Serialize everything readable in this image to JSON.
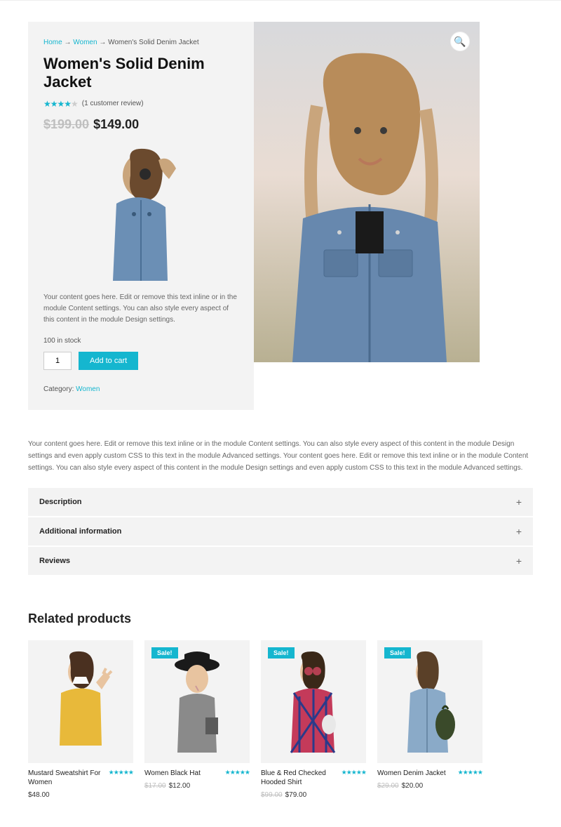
{
  "breadcrumb": {
    "home": "Home",
    "sep": "→",
    "cat": "Women",
    "current": "Women's Solid Denim Jacket"
  },
  "product": {
    "title": "Women's Solid Denim Jacket",
    "reviews_text": "(1 customer review)",
    "old_price": "$199.00",
    "price": "$149.00",
    "short_desc": "Your content goes here. Edit or remove this text inline or in the module Content settings. You can also style every aspect of this content in the module Design settings.",
    "stock": "100 in stock",
    "qty": "1",
    "add_to_cart": "Add to cart",
    "category_label": "Category:",
    "category_value": "Women"
  },
  "long_desc": "Your content goes here. Edit or remove this text inline or in the module Content settings. You can also style every aspect of this content in the module Design settings and even apply custom CSS to this text in the module Advanced settings. Your content goes here. Edit or remove this text inline or in the module Content settings. You can also style every aspect of this content in the module Design settings and even apply custom CSS to this text in the module Advanced settings.",
  "tabs": {
    "t1": "Description",
    "t2": "Additional information",
    "t3": "Reviews"
  },
  "related_heading": "Related products",
  "sale_label": "Sale!",
  "related": [
    {
      "title": "Mustard Sweatshirt For Women",
      "price": "$48.00",
      "sale": false
    },
    {
      "title": "Women Black Hat",
      "old": "$17.00",
      "price": "$12.00",
      "sale": true
    },
    {
      "title": "Blue & Red Checked Hooded Shirt",
      "old": "$99.00",
      "price": "$79.00",
      "sale": true
    },
    {
      "title": "Women Denim Jacket",
      "old": "$29.00",
      "price": "$20.00",
      "sale": true
    }
  ]
}
